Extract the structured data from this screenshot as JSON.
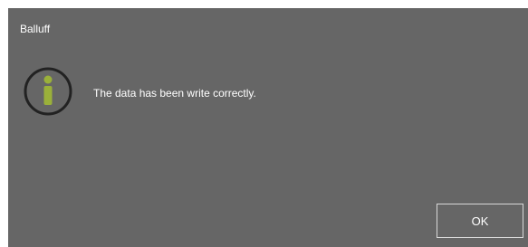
{
  "dialog": {
    "title": "Balluff",
    "icon": "info-icon",
    "message": "The data has been write correctly.",
    "ok_label": "OK"
  },
  "colors": {
    "background": "#666666",
    "icon_accent": "#9ab03a",
    "icon_ring": "#222222",
    "text": "#ffffff",
    "button_border": "#d9d9d9"
  }
}
